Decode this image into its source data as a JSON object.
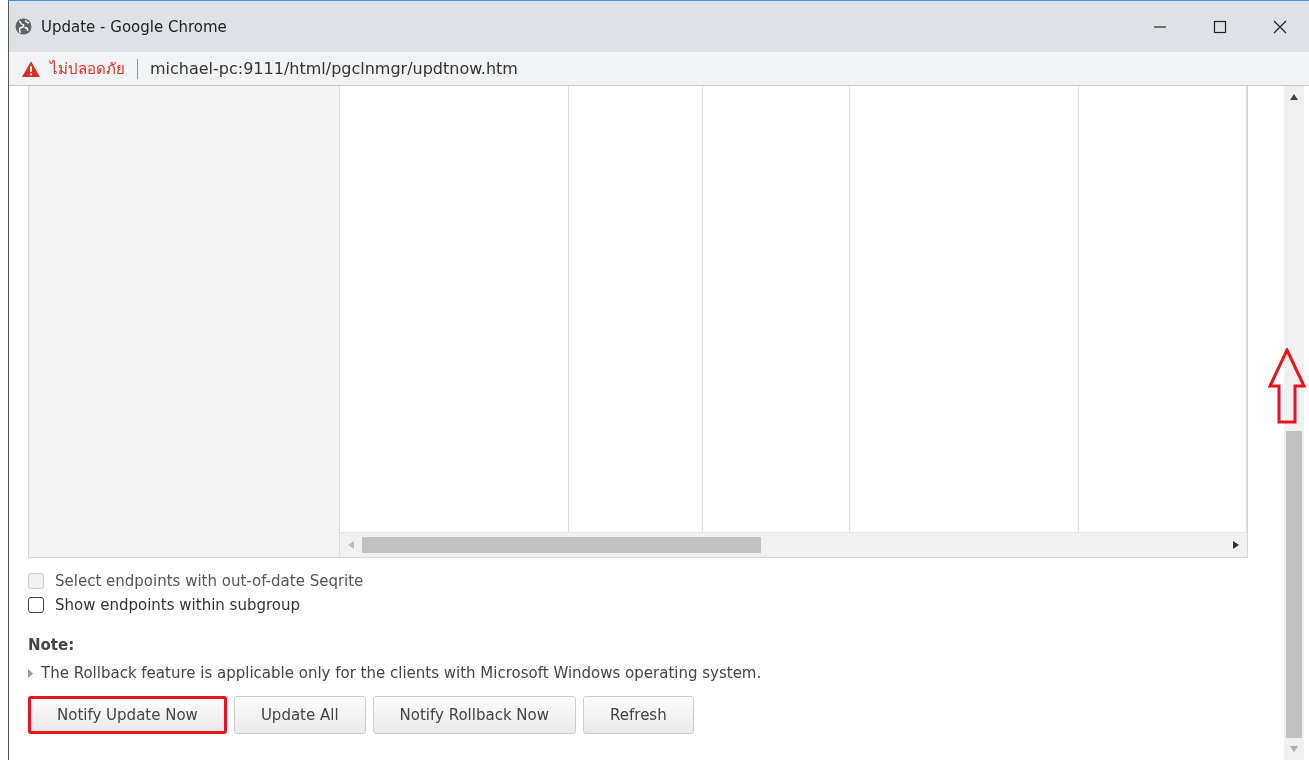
{
  "window": {
    "title": "Update - Google Chrome"
  },
  "address_bar": {
    "security_label": "ไม่ปลอดภัย",
    "url": "michael-pc:9111/html/pgclnmgr/updtnow.htm"
  },
  "options": [
    {
      "label": "Select endpoints with out-of-date Seqrite",
      "checked": false,
      "disabled": true
    },
    {
      "label": "Show endpoints within subgroup",
      "checked": false,
      "disabled": false
    }
  ],
  "note": {
    "title": "Note:",
    "text": "The Rollback feature is applicable only for the clients with Microsoft Windows operating system."
  },
  "buttons": [
    {
      "label": "Notify Update Now",
      "highlighted": true
    },
    {
      "label": "Update All",
      "highlighted": false
    },
    {
      "label": "Notify Rollback Now",
      "highlighted": false
    },
    {
      "label": "Refresh",
      "highlighted": false
    }
  ]
}
